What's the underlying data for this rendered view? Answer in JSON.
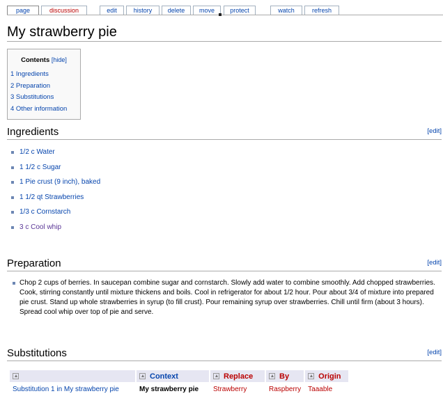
{
  "tabs": [
    {
      "label": "page",
      "selected": true
    },
    {
      "label": "discussion",
      "red": true
    },
    {
      "label": "edit"
    },
    {
      "label": "history"
    },
    {
      "label": "delete"
    },
    {
      "label": "move"
    },
    {
      "label": "protect"
    },
    {
      "label": "watch"
    },
    {
      "label": "refresh"
    }
  ],
  "page_title": "My strawberry pie",
  "toc": {
    "title": "Contents",
    "hide_label": "[hide]",
    "items": [
      "1 Ingredients",
      "2 Preparation",
      "3 Substitutions",
      "4 Other information"
    ]
  },
  "sections": {
    "ingredients": {
      "heading": "Ingredients",
      "edit": "[edit]"
    },
    "preparation": {
      "heading": "Preparation",
      "edit": "[edit]"
    },
    "substitutions": {
      "heading": "Substitutions",
      "edit": "[edit]"
    }
  },
  "ingredients": [
    "1/2 c Water",
    "1 1/2 c Sugar",
    "1 Pie crust (9 inch), baked",
    "1 1/2 qt Strawberries",
    "1/3 c Cornstarch",
    "3 c Cool whip"
  ],
  "preparation_text": "Chop 2 cups of berries. In saucepan combine sugar and cornstarch. Slowly add water to combine smoothly. Add chopped strawberries. Cook, stirring constantly until mixture thickens and boils. Cool in refrigerator for about 1/2 hour. Pour about 3/4 of mixture into prepared pie crust. Stand up whole strawberries in syrup (to fill crust). Pour remaining syrup over strawberries. Chill until firm (about 3 hours). Spread cool whip over top of pie and serve.",
  "subs_table": {
    "headers": [
      "",
      "Context",
      "Replace",
      "By",
      "Origin"
    ],
    "rows": [
      [
        "Substitution 1 in My strawberry pie",
        "My strawberry pie",
        "Strawberry",
        "Raspberry",
        "Taaable"
      ]
    ]
  },
  "colors": {
    "link": "#0645ad",
    "redlink": "#ba0000",
    "visited": "#5a3696"
  }
}
